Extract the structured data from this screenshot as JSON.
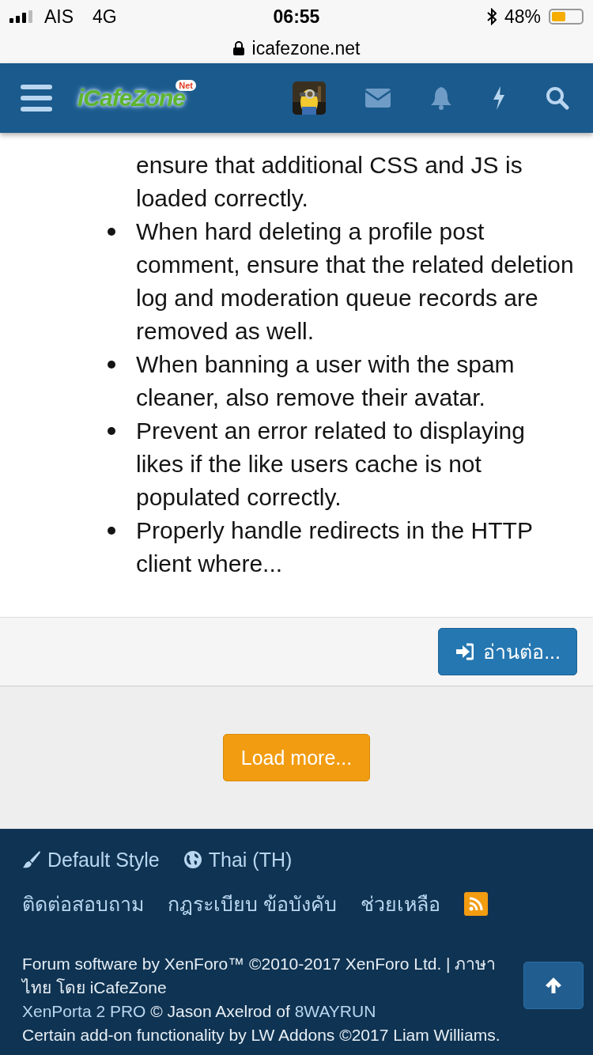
{
  "status_bar": {
    "carrier": "AIS",
    "network": "4G",
    "time": "06:55",
    "battery": "48%"
  },
  "address_bar": {
    "url": "icafezone.net"
  },
  "header": {
    "logo": "iCafeZone",
    "logo_badge": "Net"
  },
  "changes": [
    {
      "kind": "continuation",
      "text": "ensure that additional CSS and JS is loaded correctly."
    },
    {
      "kind": "item",
      "text": "When hard deleting a profile post comment, ensure that the related deletion log and moderation queue records are removed as well."
    },
    {
      "kind": "item",
      "text": "When banning a user with the spam cleaner, also remove their avatar."
    },
    {
      "kind": "item",
      "text": "Prevent an error related to displaying likes if the like users cache is not populated correctly."
    },
    {
      "kind": "item",
      "text": "Properly handle redirects in the HTTP client where..."
    }
  ],
  "read_more_button": "อ่านต่อ...",
  "load_more_button": "Load more...",
  "footer": {
    "style_chooser": "Default Style",
    "language_chooser": "Thai (TH)",
    "links": [
      "ติดต่อสอบถาม",
      "กฎระเบียบ ข้อบังคับ",
      "ช่วยเหลือ"
    ],
    "copyright": [
      {
        "kind": "text",
        "text": "Forum software by XenForo™ ©2010-2017 XenForo Ltd. | ภาษาไทย โดย iCafeZone"
      },
      {
        "kind": "links",
        "parts": [
          {
            "kind": "link",
            "text": "XenPorta 2 PRO"
          },
          {
            "kind": "text",
            "text": " © Jason Axelrod of "
          },
          {
            "kind": "link",
            "text": "8WAYRUN"
          }
        ]
      },
      {
        "kind": "text",
        "text": "Certain add-on functionality by LW Addons ©2017 Liam Williams."
      }
    ]
  }
}
